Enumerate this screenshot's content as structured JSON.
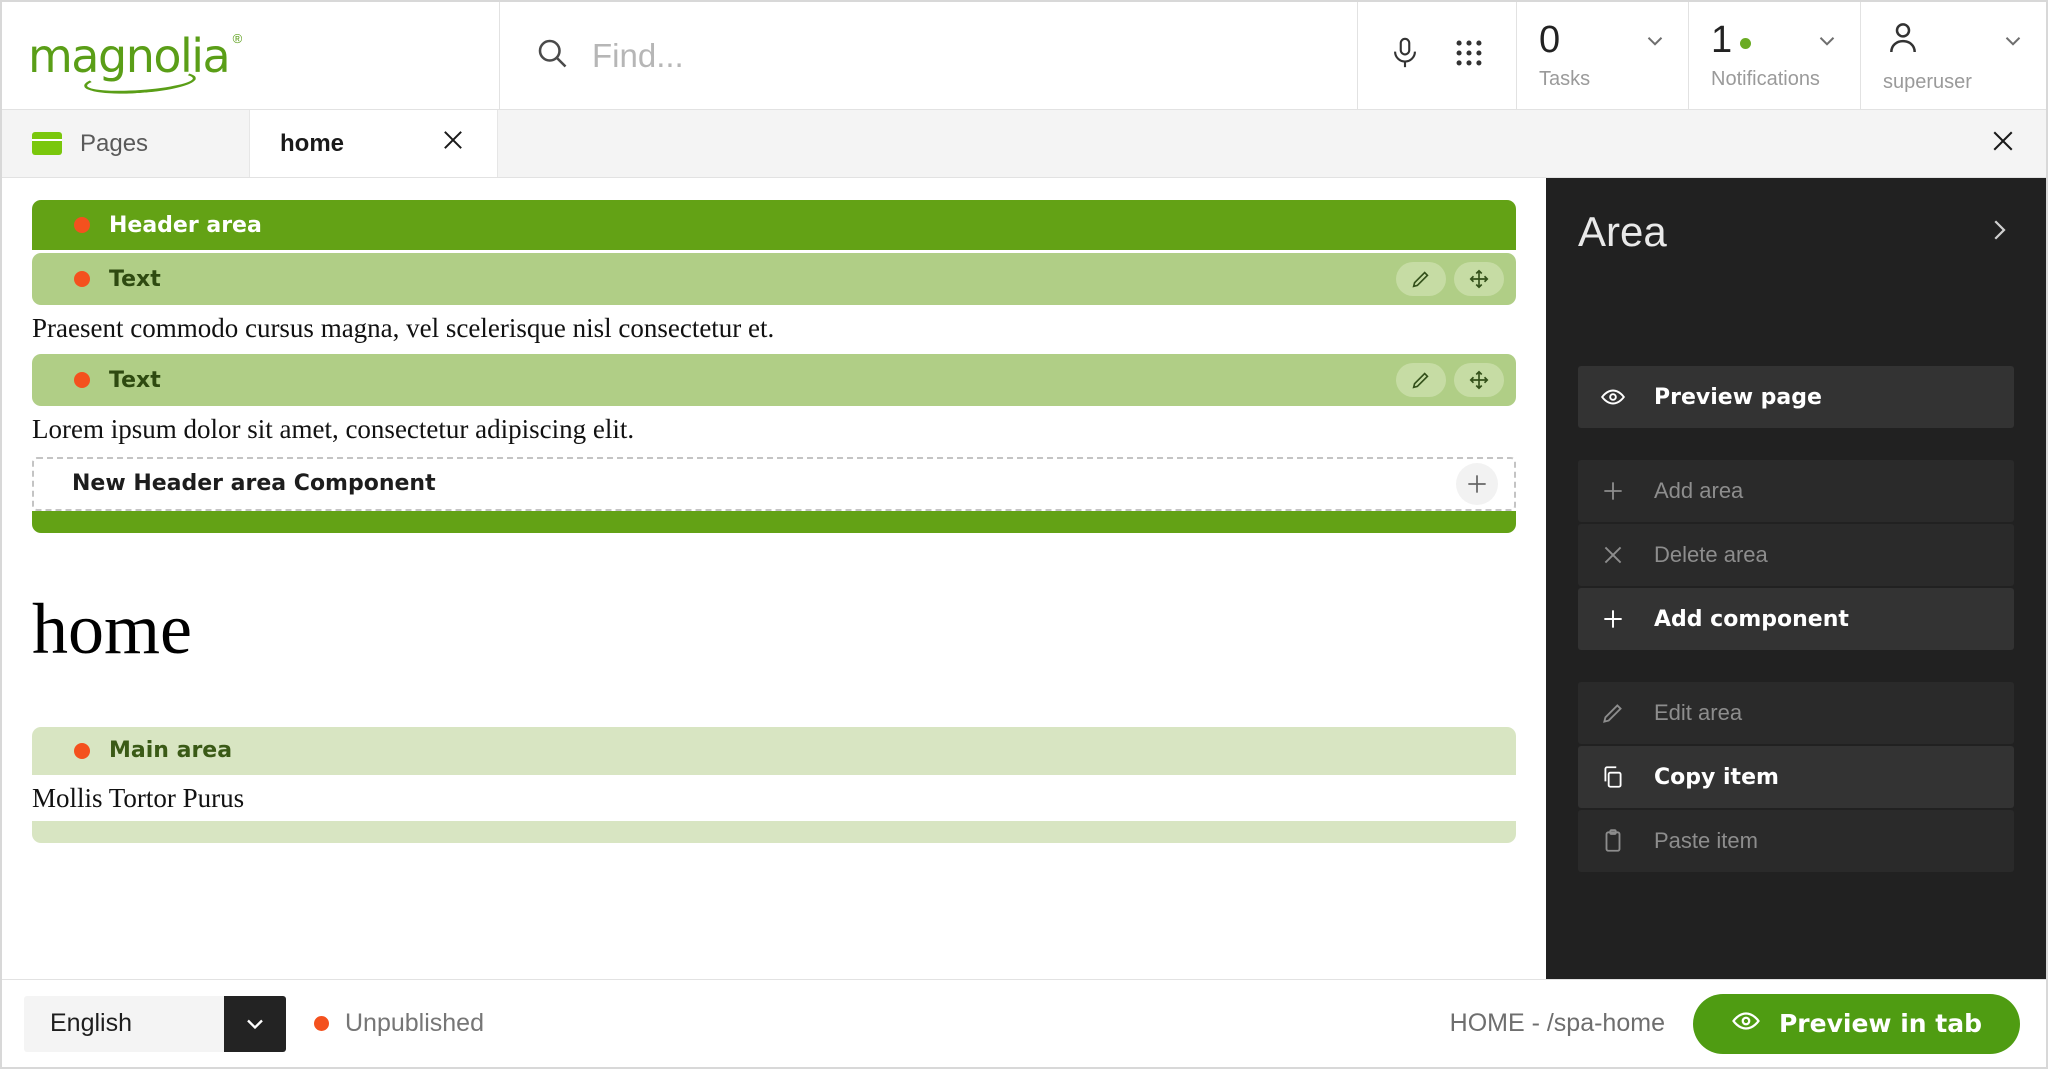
{
  "brand": {
    "name": "magnolia",
    "registered": "®",
    "color": "#5a9e17"
  },
  "search": {
    "placeholder": "Find...",
    "value": "",
    "icon": "search-icon"
  },
  "topbar": {
    "mic_icon": "microphone-icon",
    "apps_icon": "apps-grid-icon",
    "tasks": {
      "count": "0",
      "label": "Tasks"
    },
    "notifications": {
      "count": "1",
      "label": "Notifications",
      "has_new": true,
      "dot_color": "#6aab23"
    },
    "user": {
      "name": "superuser",
      "icon": "user-avatar-icon"
    }
  },
  "tabs": {
    "app_tab": {
      "label": "Pages",
      "icon": "pages-icon"
    },
    "page_tab": {
      "label": "home",
      "close_icon": "close-icon"
    },
    "close_all_icon": "close-icon"
  },
  "canvas": {
    "header_area": {
      "label": "Header area",
      "dot_color": "#f4511e",
      "components": [
        {
          "label": "Text",
          "dot_color": "#f4511e",
          "edit_icon": "pencil-icon",
          "move_icon": "move-arrows-icon",
          "content": "Praesent commodo cursus magna, vel scelerisque nisl consectetur et."
        },
        {
          "label": "Text",
          "dot_color": "#f4511e",
          "edit_icon": "pencil-icon",
          "move_icon": "move-arrows-icon",
          "content": "Lorem ipsum dolor sit amet, consectetur adipiscing elit."
        }
      ],
      "new_component": {
        "label": "New Header area Component",
        "add_icon": "plus-icon"
      }
    },
    "page_title": "home",
    "main_area": {
      "label": "Main area",
      "dot_color": "#f4511e",
      "content": "Mollis Tortor Purus"
    }
  },
  "right_panel": {
    "title": "Area",
    "collapse_icon": "chevron-right-icon",
    "groups": [
      {
        "items": [
          {
            "label": "Preview page",
            "icon": "eye-icon",
            "enabled": true
          }
        ]
      },
      {
        "items": [
          {
            "label": "Add area",
            "icon": "plus-icon",
            "enabled": false
          },
          {
            "label": "Delete area",
            "icon": "close-icon",
            "enabled": false
          },
          {
            "label": "Add component",
            "icon": "plus-icon",
            "enabled": true
          }
        ]
      },
      {
        "items": [
          {
            "label": "Edit area",
            "icon": "pencil-icon",
            "enabled": false
          },
          {
            "label": "Copy item",
            "icon": "copy-icon",
            "enabled": true
          },
          {
            "label": "Paste item",
            "icon": "clipboard-icon",
            "enabled": false
          }
        ]
      }
    ]
  },
  "footer": {
    "language": {
      "value": "English",
      "chevron_icon": "chevron-down-icon"
    },
    "status": {
      "label": "Unpublished",
      "dot_color": "#f4511e"
    },
    "path": "HOME - /spa-home",
    "preview_button": {
      "label": "Preview in tab",
      "icon": "eye-icon",
      "color": "#4f9c12"
    }
  }
}
